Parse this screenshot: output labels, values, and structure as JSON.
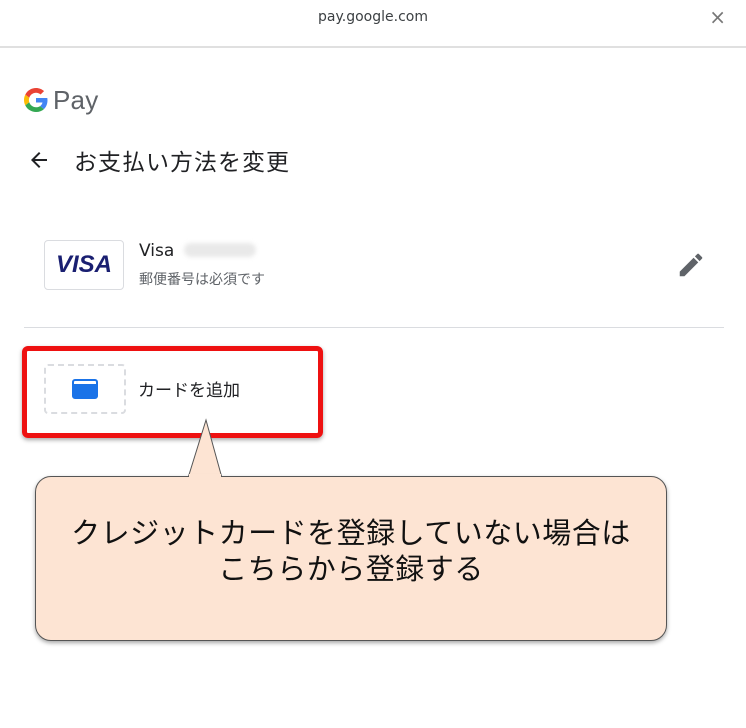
{
  "window": {
    "url": "pay.google.com",
    "close_symbol": "×"
  },
  "brand": {
    "name": "Pay"
  },
  "header": {
    "title": "お支払い方法を変更"
  },
  "payment_methods": [
    {
      "logo_text": "VISA",
      "name": "Visa",
      "status": "郵便番号は必須です"
    }
  ],
  "add_card": {
    "label": "カードを追加"
  },
  "annotation": {
    "line1": "クレジットカードを登録していない場合は",
    "line2": "こちらから登録する",
    "highlight_color": "#ee1111",
    "bubble_color": "#fde4d3"
  },
  "icons": {
    "back": "arrow-back-icon",
    "edit": "pencil-icon",
    "card": "credit-card-icon",
    "close": "close-icon"
  }
}
